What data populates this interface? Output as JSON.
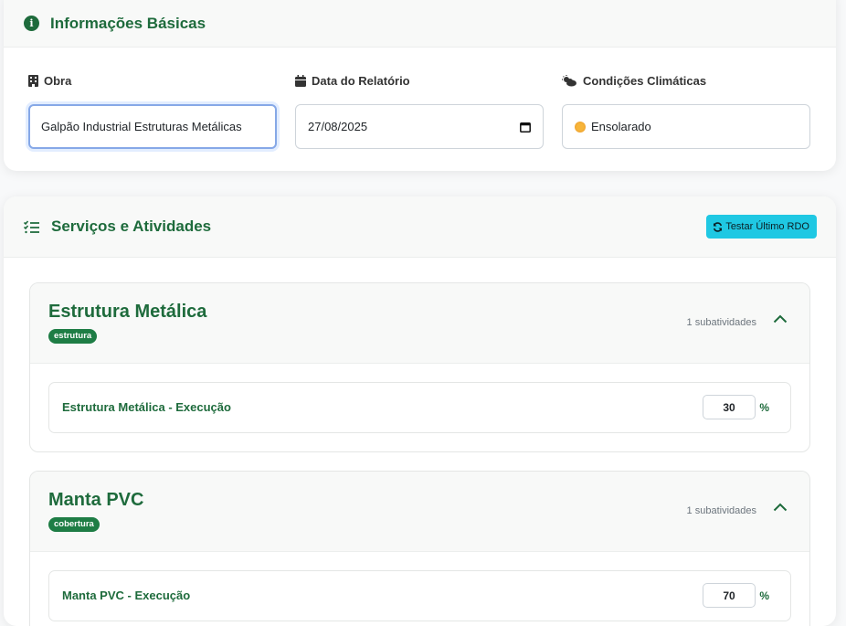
{
  "basic_info": {
    "title": "Informações Básicas",
    "obra": {
      "label": "Obra",
      "value": "Galpão Industrial Estruturas Metálicas"
    },
    "data": {
      "label": "Data do Relatório",
      "value": "27/08/2025"
    },
    "clima": {
      "label": "Condições Climáticas",
      "value": "Ensolarado"
    }
  },
  "services": {
    "title": "Serviços e Atividades",
    "test_button_label": "Testar Último RDO",
    "groups": [
      {
        "title": "Estrutura Metálica",
        "badge": "estrutura",
        "sub_count": "1 subatividades",
        "activities": [
          {
            "label": "Estrutura Metálica - Execução",
            "percent": "30",
            "unit": "%"
          }
        ]
      },
      {
        "title": "Manta PVC",
        "badge": "cobertura",
        "sub_count": "1 subatividades",
        "activities": [
          {
            "label": "Manta PVC - Execução",
            "percent": "70",
            "unit": "%"
          }
        ]
      }
    ]
  },
  "colors": {
    "primary_green": "#1e6b3c",
    "badge_green": "#1e7d45",
    "info_button": "#1fc8e3"
  }
}
